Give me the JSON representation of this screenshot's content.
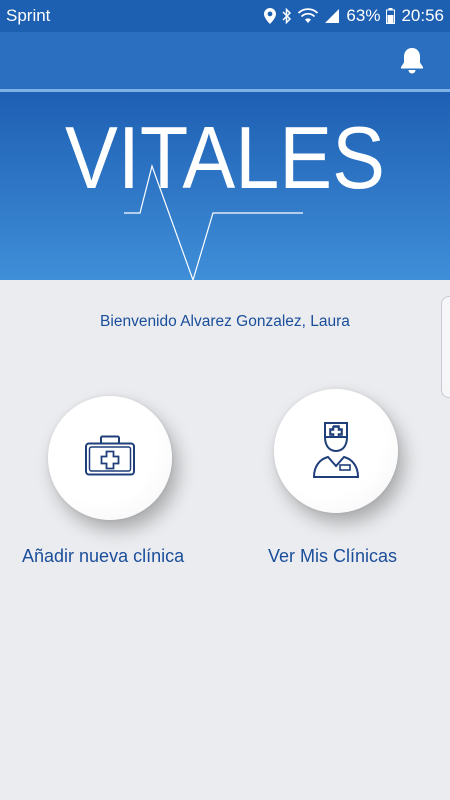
{
  "status_bar": {
    "carrier": "Sprint",
    "battery_percent": "63%",
    "time": "20:56"
  },
  "header": {
    "logo_text": "VITALES"
  },
  "welcome_text": "Bienvenido Alvarez Gonzalez, Laura",
  "actions": [
    {
      "label": "Añadir nueva clínica",
      "icon": "medical-kit-icon"
    },
    {
      "label": "Ver Mis Clínicas",
      "icon": "doctor-icon"
    }
  ],
  "colors": {
    "primary": "#1e5fb3",
    "accent_light": "#3f8ed8",
    "text_blue": "#1a4e9b",
    "background": "#ebecef"
  }
}
